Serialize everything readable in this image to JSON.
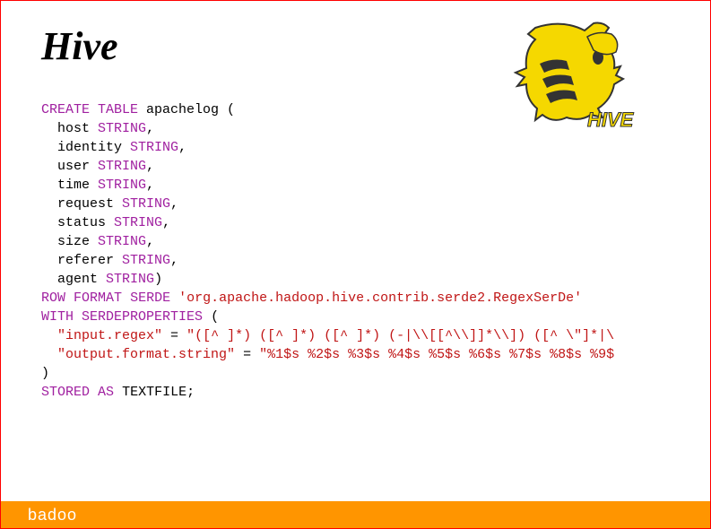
{
  "title": "Hive",
  "footer_brand": "badoo",
  "code": {
    "kw_create": "CREATE TABLE",
    "table_name": "apachelog (",
    "col_host": "host",
    "col_identity": "identity",
    "col_user": "user",
    "col_time": "time",
    "col_request": "request",
    "col_status": "status",
    "col_size": "size",
    "col_referer": "referer",
    "col_agent": "agent",
    "type_string": "STRING",
    "comma": ",",
    "close_paren": ")",
    "kw_row": "ROW",
    "kw_format": "FORMAT",
    "kw_serde": "SERDE",
    "serde_class": "'org.apache.hadoop.hive.contrib.serde2.RegexSerDe'",
    "kw_with": "WITH",
    "kw_serdeproperties": "SERDEPROPERTIES",
    "open_paren": "(",
    "input_regex_key": "\"input.regex\"",
    "eq": " = ",
    "input_regex_val": "\"([^ ]*) ([^ ]*) ([^ ]*) (-|\\\\[[^\\\\]]*\\\\]) ([^ \\\"]*|\\",
    "output_key": "\"output.format.string\"",
    "output_val": "\"%1$s %2$s %3$s %4$s %5$s %6$s %7$s %8$s %9$",
    "kw_stored": "STORED",
    "kw_as": "AS",
    "kw_textfile": "TEXTFILE;"
  }
}
